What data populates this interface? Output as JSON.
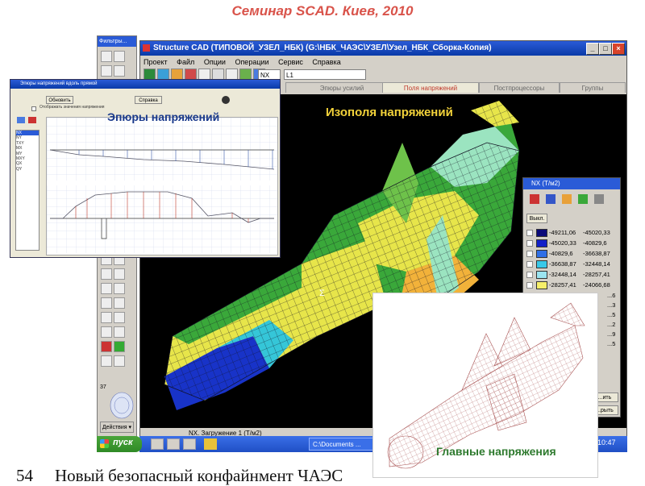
{
  "slide": {
    "title": "Семинар SCAD. Киев, 2010",
    "number": "54",
    "bottom_text": "Новый безопасный конфайнмент ЧАЭС"
  },
  "scad": {
    "title": "Structure CAD (ТИПОВОЙ_УЗЕЛ_НБК) (G:\\НБК_ЧАЭС\\УЗЕЛ\\Узел_НБК_Сборка-Копия)",
    "menu": [
      "Проект",
      "Файл",
      "Опции",
      "Операции",
      "Сервис",
      "Справка"
    ],
    "combo_nx": "NX",
    "combo_load": "L1",
    "tabs": [
      "Эпюры усилий",
      "Поля напряжений",
      "Постпроцессоры",
      "Группы"
    ],
    "active_tab": "Поля напряжений",
    "status": "NX. Загружение 1 (Т/м2)",
    "overlay_label": "Изополя напряжений"
  },
  "filter_panel": {
    "title": "Фильтры...",
    "page_label": "37",
    "action_button": "Действия ▾"
  },
  "epures": {
    "title": "Эпюры напряжений вдоль прямой",
    "button_update": "Обновить",
    "button_help": "Справка",
    "checkbox_label": "Отображать значения напряжения",
    "overlay_label": "Эпюры напряжений",
    "list_items": [
      "NX",
      "NY",
      "TXY",
      "MX",
      "MY",
      "MXY",
      "QX",
      "QY"
    ]
  },
  "legend": {
    "title": "NX (Т/м2)",
    "off_button": "Выкл.",
    "button_apply": "...ить",
    "button_close": "...рыть",
    "rows": [
      {
        "from": "-49211,06",
        "to": "-45020,33",
        "color": "#0b0b7a"
      },
      {
        "from": "-45020,33",
        "to": "-40829,6",
        "color": "#1220c8"
      },
      {
        "from": "-40829,6",
        "to": "-36638,87",
        "color": "#2f6fe6"
      },
      {
        "from": "-36638,87",
        "to": "-32448,14",
        "color": "#38c8e8"
      },
      {
        "from": "-32448,14",
        "to": "-28257,41",
        "color": "#9be4f0"
      },
      {
        "from": "-28257,41",
        "to": "-24066,68",
        "color": "#f6ef6a"
      }
    ],
    "partial_values": [
      "...6",
      "...3",
      "...5",
      "...2",
      "...9",
      "...5"
    ]
  },
  "principal": {
    "overlay_label": "Главные напряжения"
  },
  "taskbar": {
    "start_label": "пуск",
    "task_item": "C:\\Documents ...",
    "clock": "10:47"
  },
  "colors": {
    "title_red": "#d9534a",
    "overlay_blue": "#1a3a8c",
    "overlay_yellow": "#f2d23a",
    "overlay_green": "#2e7a2e",
    "mesh_green": "#3aa83a",
    "mesh_yellow": "#e7e54a",
    "mesh_cyan": "#35c6d8",
    "mesh_blue": "#1833c8"
  }
}
